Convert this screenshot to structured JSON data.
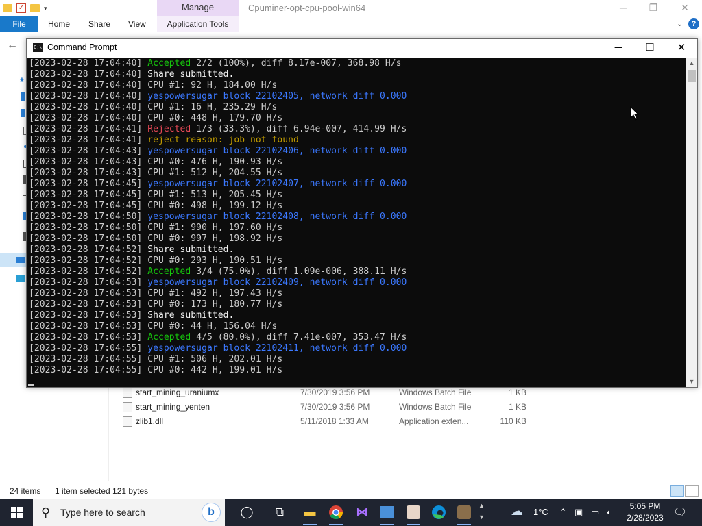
{
  "explorer": {
    "ribbon_context_tab": "Manage",
    "window_title": "Cpuminer-opt-cpu-pool-win64",
    "tabs": {
      "file": "File",
      "home": "Home",
      "share": "Share",
      "view": "View",
      "app_tools": "Application Tools"
    },
    "files": [
      {
        "name": "start_mining_uraniumx",
        "date": "7/30/2019 3:56 PM",
        "type": "Windows Batch File",
        "size": "1 KB"
      },
      {
        "name": "start_mining_yenten",
        "date": "7/30/2019 3:56 PM",
        "type": "Windows Batch File",
        "size": "1 KB"
      },
      {
        "name": "zlib1.dll",
        "date": "5/11/2018 1:33 AM",
        "type": "Application exten...",
        "size": "110 KB"
      }
    ],
    "status": {
      "items": "24 items",
      "selected": "1 item selected  121 bytes"
    }
  },
  "cmd": {
    "title": "Command Prompt",
    "lines": [
      {
        "ts": "[2023-02-28 17:04:40] ",
        "hl": "Accepted",
        "cls": "g",
        "rest": " 2/2 (100%), diff 8.17e-007, 368.98 H/s"
      },
      {
        "ts": "[2023-02-28 17:04:40] ",
        "hl": "Share submitted.",
        "cls": "wt",
        "rest": ""
      },
      {
        "ts": "[2023-02-28 17:04:40] ",
        "hl": "",
        "cls": "",
        "rest": "CPU #1: 92 H, 184.00 H/s"
      },
      {
        "ts": "[2023-02-28 17:04:40] ",
        "hl": "yespowersugar block 22102405, network diff 0.000",
        "cls": "b",
        "rest": ""
      },
      {
        "ts": "[2023-02-28 17:04:40] ",
        "hl": "",
        "cls": "",
        "rest": "CPU #1: 16 H, 235.29 H/s"
      },
      {
        "ts": "[2023-02-28 17:04:40] ",
        "hl": "",
        "cls": "",
        "rest": "CPU #0: 448 H, 179.70 H/s"
      },
      {
        "ts": "[2023-02-28 17:04:41] ",
        "hl": "Rejected",
        "cls": "r",
        "rest": " 1/3 (33.3%), diff 6.94e-007, 414.99 H/s"
      },
      {
        "ts": "[2023-02-28 17:04:41] ",
        "hl": "reject reason: job not found",
        "cls": "y",
        "rest": ""
      },
      {
        "ts": "[2023-02-28 17:04:43] ",
        "hl": "yespowersugar block 22102406, network diff 0.000",
        "cls": "b",
        "rest": ""
      },
      {
        "ts": "[2023-02-28 17:04:43] ",
        "hl": "",
        "cls": "",
        "rest": "CPU #0: 476 H, 190.93 H/s"
      },
      {
        "ts": "[2023-02-28 17:04:43] ",
        "hl": "",
        "cls": "",
        "rest": "CPU #1: 512 H, 204.55 H/s"
      },
      {
        "ts": "[2023-02-28 17:04:45] ",
        "hl": "yespowersugar block 22102407, network diff 0.000",
        "cls": "b",
        "rest": ""
      },
      {
        "ts": "[2023-02-28 17:04:45] ",
        "hl": "",
        "cls": "",
        "rest": "CPU #1: 513 H, 205.45 H/s"
      },
      {
        "ts": "[2023-02-28 17:04:45] ",
        "hl": "",
        "cls": "",
        "rest": "CPU #0: 498 H, 199.12 H/s"
      },
      {
        "ts": "[2023-02-28 17:04:50] ",
        "hl": "yespowersugar block 22102408, network diff 0.000",
        "cls": "b",
        "rest": ""
      },
      {
        "ts": "[2023-02-28 17:04:50] ",
        "hl": "",
        "cls": "",
        "rest": "CPU #1: 990 H, 197.60 H/s"
      },
      {
        "ts": "[2023-02-28 17:04:50] ",
        "hl": "",
        "cls": "",
        "rest": "CPU #0: 997 H, 198.92 H/s"
      },
      {
        "ts": "[2023-02-28 17:04:52] ",
        "hl": "Share submitted.",
        "cls": "wt",
        "rest": ""
      },
      {
        "ts": "[2023-02-28 17:04:52] ",
        "hl": "",
        "cls": "",
        "rest": "CPU #0: 293 H, 190.51 H/s"
      },
      {
        "ts": "[2023-02-28 17:04:52] ",
        "hl": "Accepted",
        "cls": "g",
        "rest": " 3/4 (75.0%), diff 1.09e-006, 388.11 H/s"
      },
      {
        "ts": "[2023-02-28 17:04:53] ",
        "hl": "yespowersugar block 22102409, network diff 0.000",
        "cls": "b",
        "rest": ""
      },
      {
        "ts": "[2023-02-28 17:04:53] ",
        "hl": "",
        "cls": "",
        "rest": "CPU #1: 492 H, 197.43 H/s"
      },
      {
        "ts": "[2023-02-28 17:04:53] ",
        "hl": "",
        "cls": "",
        "rest": "CPU #0: 173 H, 180.77 H/s"
      },
      {
        "ts": "[2023-02-28 17:04:53] ",
        "hl": "Share submitted.",
        "cls": "wt",
        "rest": ""
      },
      {
        "ts": "[2023-02-28 17:04:53] ",
        "hl": "",
        "cls": "",
        "rest": "CPU #0: 44 H, 156.04 H/s"
      },
      {
        "ts": "[2023-02-28 17:04:53] ",
        "hl": "Accepted",
        "cls": "g",
        "rest": " 4/5 (80.0%), diff 7.41e-007, 353.47 H/s"
      },
      {
        "ts": "[2023-02-28 17:04:55] ",
        "hl": "yespowersugar block 22102411, network diff 0.000",
        "cls": "b",
        "rest": ""
      },
      {
        "ts": "[2023-02-28 17:04:55] ",
        "hl": "",
        "cls": "",
        "rest": "CPU #1: 506 H, 202.01 H/s"
      },
      {
        "ts": "[2023-02-28 17:04:55] ",
        "hl": "",
        "cls": "",
        "rest": "CPU #0: 442 H, 199.01 H/s"
      }
    ]
  },
  "taskbar": {
    "search_placeholder": "Type here to search",
    "temperature": "1°C",
    "time": "5:05 PM",
    "date": "2/28/2023"
  },
  "colors": {
    "accepted": "#16c60c",
    "rejected": "#e74856",
    "warning": "#c19c00",
    "block": "#3b78ff",
    "file_tab": "#1979ca"
  },
  "icons": [
    "folder-icon",
    "properties-icon",
    "minimize-icon",
    "maximize-icon",
    "close-icon",
    "back-arrow-icon",
    "help-icon",
    "cmd-icon",
    "batch-file-icon",
    "dll-file-icon",
    "windows-start-icon",
    "search-icon",
    "bing-icon",
    "cortana-icon",
    "task-view-icon",
    "file-explorer-icon",
    "chrome-icon",
    "visual-studio-icon",
    "edge-icon",
    "weather-icon",
    "notification-icon"
  ]
}
